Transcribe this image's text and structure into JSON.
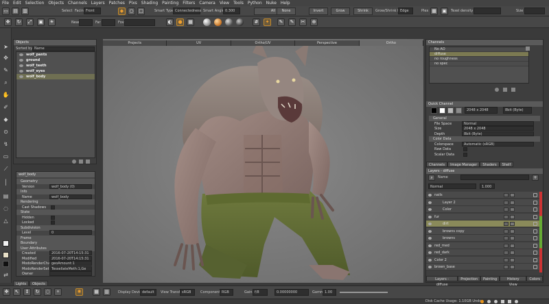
{
  "menu": [
    "File",
    "Edit",
    "Selection",
    "Objects",
    "Channels",
    "Layers",
    "Patches",
    "Pixs",
    "Shading",
    "Painting",
    "Filters",
    "Camera",
    "View",
    "Tools",
    "Python",
    "Nuke",
    "Help"
  ],
  "toolbar1": {
    "select_label": "Select",
    "facing_label": "Facing",
    "facing_value": "Front",
    "smart_type_label": "Smart Type:",
    "smart_type_value": "Connectedness",
    "smart_angle_label": "Smart Angle",
    "smart_angle_value": "0.300",
    "all": "All",
    "none": "None",
    "invert": "Invert",
    "grow": "Grow",
    "shrink": "Shrink",
    "grow_shrink_label": "Grow/Shrink by",
    "grow_shrink_value": "Edge",
    "plex_label": "Plex",
    "texel_label": "Texel density",
    "size_label": "Size"
  },
  "toolbar2": {
    "near_label": "Near",
    "far_label": "Far",
    "fov_label": "Fov"
  },
  "objects": {
    "title": "Objects",
    "sorted_label": "Sorted by",
    "sorted_value": "Name",
    "items": [
      "wolf_pants",
      "ground",
      "wolf_teeth",
      "wolf_eyes",
      "wolf_body"
    ]
  },
  "properties": {
    "header": "wolf_body",
    "rows": [
      {
        "type": "sec",
        "label": "Geometry"
      },
      {
        "k": "Version",
        "v": "wolf_body (0)"
      },
      {
        "type": "sec",
        "label": "Info"
      },
      {
        "k": "Name",
        "v": "wolf_body"
      },
      {
        "type": "sec",
        "label": "Rendering"
      },
      {
        "k": "Cast Shadows",
        "chk": true
      },
      {
        "type": "sec",
        "label": "State"
      },
      {
        "k": "Hidden",
        "chk": true
      },
      {
        "k": "Locked",
        "chk": true
      },
      {
        "type": "sec",
        "label": "Subdivision"
      },
      {
        "k": "Level",
        "v": "0"
      },
      {
        "type": "sec",
        "label": "Frame"
      },
      {
        "type": "sec",
        "label": "Boundary"
      },
      {
        "type": "sec",
        "label": "User Attributes"
      },
      {
        "k": "Created",
        "v": "2016-07-20T14:15:31"
      },
      {
        "k": "Modified",
        "v": "2016-07-20T14:15:31"
      },
      {
        "k": "ModoRenderChannelAssignments",
        "v": "geoAmount:1"
      },
      {
        "k": "ModoRenderSettings",
        "v": "TessellateMeth:1,Ge"
      },
      {
        "k": "Owner",
        "v": ""
      }
    ]
  },
  "left_tabs": [
    "Lights",
    "Objects"
  ],
  "viewport_tabs": [
    "Projects",
    "UV",
    "Ortho/UV",
    "Perspective",
    "Ortho"
  ],
  "channels": {
    "title": "Channels",
    "items": [
      "No AO",
      "diffuse",
      "no roughness",
      "no spec"
    ],
    "quick_channel": "Quick Channel",
    "resolution": "2048 x 2048",
    "depth_value": "8bit (Byte)",
    "sections": [
      {
        "type": "sec",
        "label": "General"
      },
      {
        "k": "File Space",
        "v": "Normal"
      },
      {
        "k": "Size",
        "v": "2048 x 2048"
      },
      {
        "k": "Depth",
        "v": "8bit (Byte)"
      },
      {
        "type": "sec",
        "label": "Color Data"
      },
      {
        "k": "Colorspace",
        "v": "Automatic (sRGB)"
      },
      {
        "k": "Raw Data",
        "chk": true
      },
      {
        "k": "Scalar Data",
        "chk": true
      }
    ],
    "tabs": [
      "Channels",
      "Image Manager",
      "Shaders",
      "Shelf"
    ]
  },
  "layers": {
    "title": "Layers - diffuse",
    "name_label": "Name",
    "blend_value": "Normal",
    "opacity_value": "1.000",
    "rows": [
      {
        "name": "nails",
        "indent": 0,
        "hl": false
      },
      {
        "name": "Layer 2",
        "indent": 1,
        "hl": false
      },
      {
        "name": "Color",
        "indent": 1,
        "hl": false
      },
      {
        "name": "fur",
        "indent": 0,
        "hl": false
      },
      {
        "name": "dirt",
        "indent": 1,
        "hl": true
      },
      {
        "name": "browns copy",
        "indent": 1,
        "hl": false
      },
      {
        "name": "browns",
        "indent": 1,
        "hl": false
      },
      {
        "name": "red_med",
        "indent": 0,
        "hl": false
      },
      {
        "name": "red_dark",
        "indent": 0,
        "hl": false
      },
      {
        "name": "Color 2",
        "indent": 0,
        "hl": false
      },
      {
        "name": "brown_base",
        "indent": 0,
        "hl": false
      }
    ],
    "tabs": [
      "Layers - diffuse",
      "Projection",
      "Painting",
      "History View",
      "Colors"
    ]
  },
  "bottom": {
    "display_device_label": "Display Device",
    "display_device_value": "default",
    "view_transform_label": "View Transform",
    "view_transform_value": "sRGB",
    "component_label": "Component",
    "component_value": "RGB",
    "gain_label": "Gain",
    "gain_value": "f/8",
    "gamma_label": "Gamma",
    "gamma_value": "1.00",
    "value_field": "0.00000000"
  },
  "status": {
    "cache": "Disk Cache Usage: 1.10GB  Undo:"
  },
  "colors": {
    "accent": "#e8941a",
    "highlight_row": "#8a8a5a",
    "selected_obj": "#6f6f52"
  }
}
